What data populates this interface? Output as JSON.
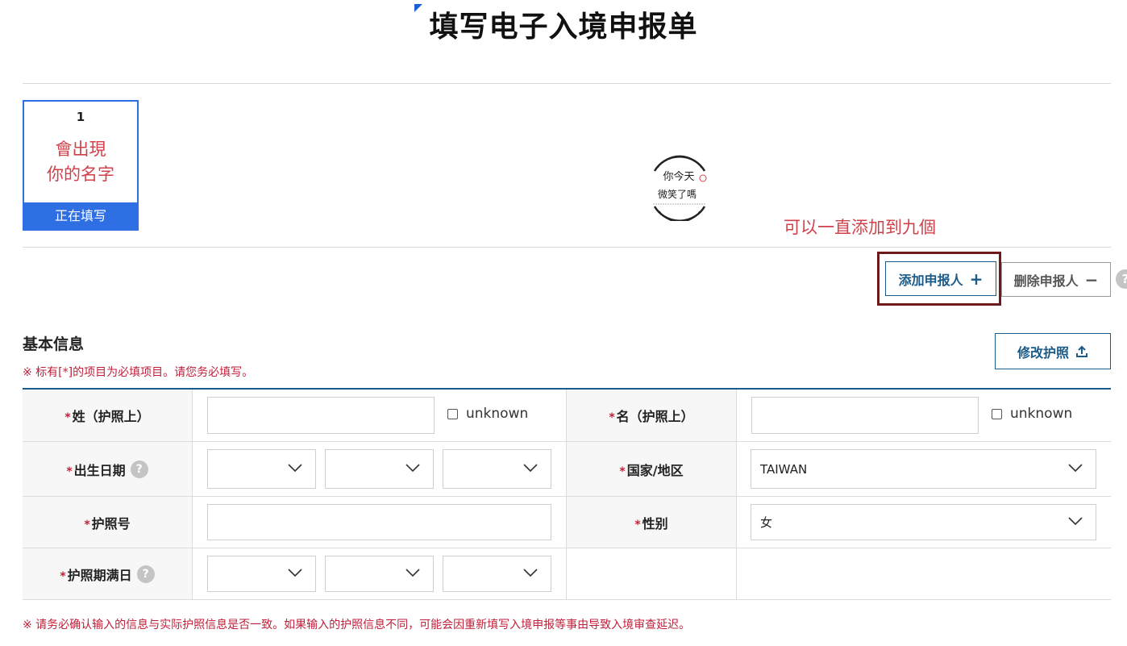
{
  "page": {
    "title": "填写电子入境申报单"
  },
  "applicants": [
    {
      "number": "1",
      "name": "會出現\n你的名字",
      "status": "正在填写"
    }
  ],
  "annotation": "可以一直添加到九個",
  "buttons": {
    "add": "添加申报人",
    "add_icon": "+",
    "delete": "删除申报人",
    "delete_icon": "−",
    "edit_passport": "修改护照"
  },
  "section": {
    "title": "基本信息",
    "required_note": "※ 标有[*]的项目为必填项目。请您务必填写。",
    "bottom_note": "※ 请务必确认输入的信息与实际护照信息是否一致。如果输入的护照信息不同，可能会因重新填写入境申报等事由导致入境审查延迟。"
  },
  "form": {
    "required_mark": "*",
    "help": "?",
    "surname": {
      "label": "姓（护照上）",
      "value": "",
      "unknown_label": "unknown"
    },
    "given_name": {
      "label": "名（护照上）",
      "value": "",
      "unknown_label": "unknown"
    },
    "birth_date": {
      "label": "出生日期",
      "year": "",
      "month": "",
      "day": ""
    },
    "country": {
      "label": "国家/地区",
      "value": "TAIWAN"
    },
    "passport_no": {
      "label": "护照号",
      "value": ""
    },
    "gender": {
      "label": "性别",
      "value": "女"
    },
    "passport_expiry": {
      "label": "护照期满日",
      "year": "",
      "month": "",
      "day": ""
    }
  },
  "watermark": {
    "line1": "你今天",
    "line2": "微笑了嗎"
  }
}
